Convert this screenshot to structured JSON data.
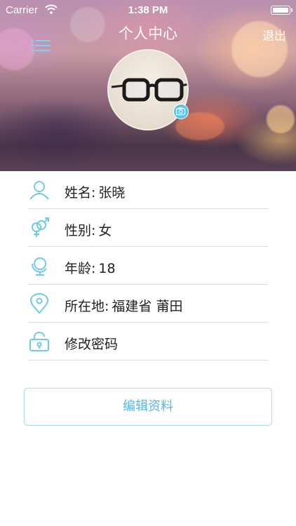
{
  "status_bar": {
    "carrier": "Carrier",
    "time": "1:38 PM",
    "battery_level": 1.0
  },
  "header": {
    "title": "个人中心",
    "logout_label": "退出",
    "menu_icon": "list-icon",
    "camera_icon": "camera-icon"
  },
  "profile": {
    "items": [
      {
        "label": "姓名:",
        "value": "张晓",
        "icon": "user-icon"
      },
      {
        "label": "性别:",
        "value": "女",
        "icon": "gender-icon"
      },
      {
        "label": "年龄:",
        "value": "18",
        "icon": "globe-icon"
      },
      {
        "label": "所在地:",
        "value": "福建省 莆田",
        "icon": "location-pin-icon"
      },
      {
        "label": "修改密码",
        "value": "",
        "icon": "lock-icon"
      }
    ]
  },
  "actions": {
    "edit_label": "编辑资料"
  },
  "colors": {
    "accent": "#5ab6df",
    "icon": "#6fcbe9",
    "divider": "#dcdcdc"
  }
}
